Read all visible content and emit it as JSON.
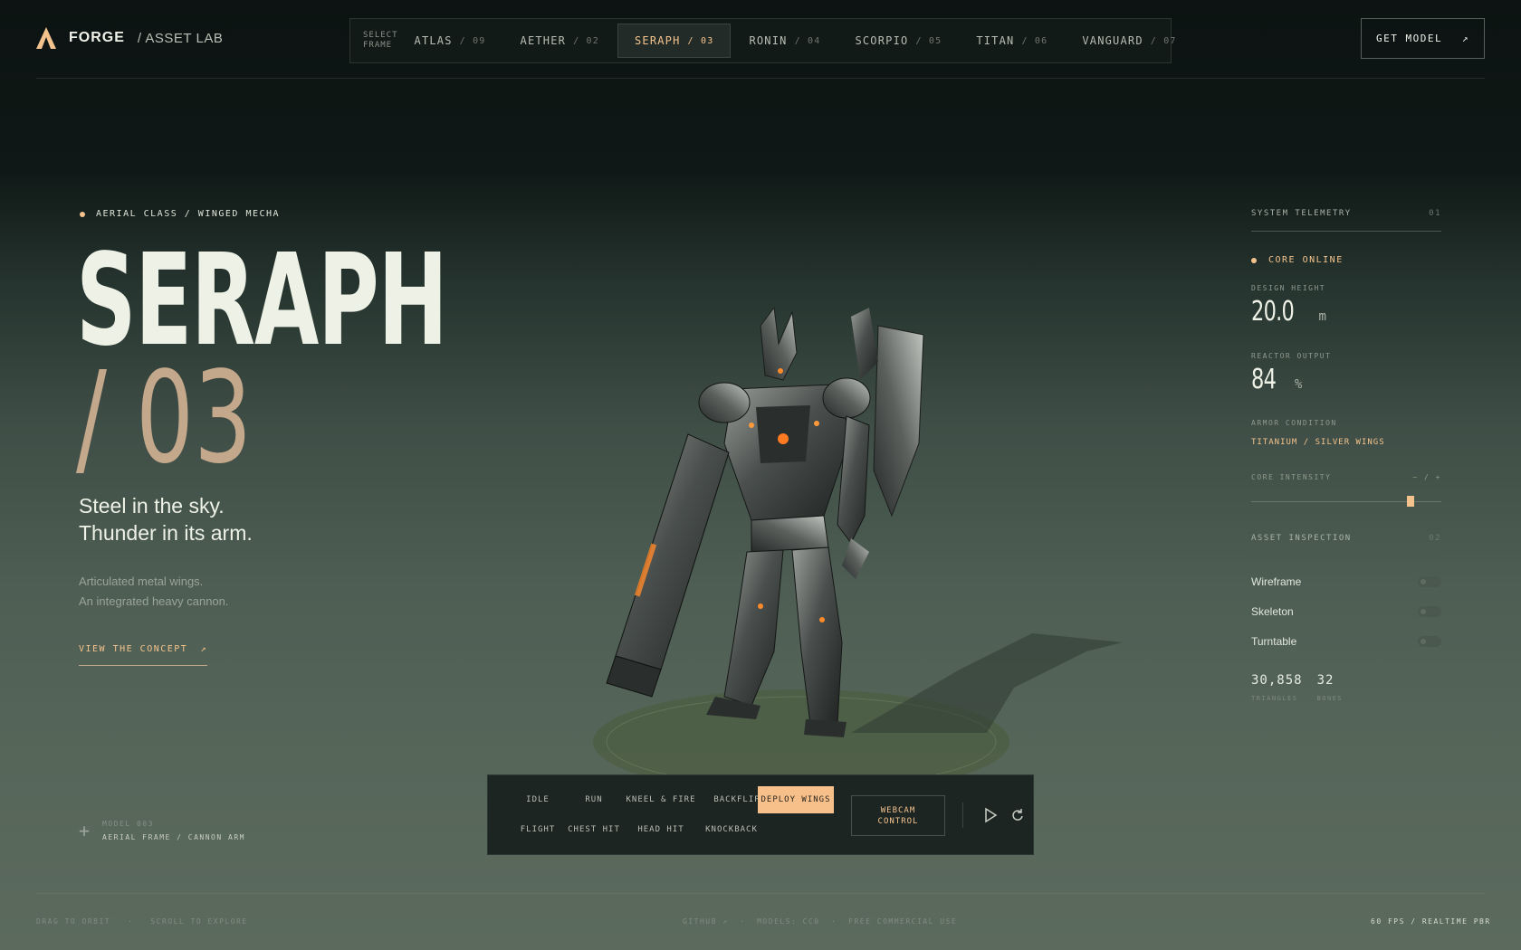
{
  "brand": {
    "name": "FORGE",
    "sub": "/ ASSET LAB"
  },
  "nav": {
    "label": "SELECT FRAME",
    "tabs": [
      {
        "name": "ATLAS",
        "num": "/ 09"
      },
      {
        "name": "AETHER",
        "num": "/ 02"
      },
      {
        "name": "SERAPH",
        "num": "/ 03",
        "active": true
      },
      {
        "name": "RONIN",
        "num": "/ 04"
      },
      {
        "name": "SCORPIO",
        "num": "/ 05"
      },
      {
        "name": "TITAN",
        "num": "/ 06"
      },
      {
        "name": "VANGUARD",
        "num": "/ 07"
      }
    ]
  },
  "header": {
    "get_model": "GET MODEL",
    "get_model_icon": "↗"
  },
  "hero": {
    "class_tag": "AERIAL CLASS / WINGED MECHA",
    "name": "SERAPH",
    "number": "/ 03",
    "tagline_1": "Steel in the sky.",
    "tagline_2": "Thunder in its arm.",
    "desc_1": "Articulated metal wings.",
    "desc_2": "An integrated heavy cannon.",
    "link": "VIEW THE CONCEPT",
    "link_icon": "↗"
  },
  "model_note": {
    "plus": "+",
    "line1": "MODEL 003",
    "line2": "AERIAL FRAME / CANNON ARM"
  },
  "telemetry": {
    "title": "SYSTEM TELEMETRY",
    "index": "01",
    "status": "CORE ONLINE",
    "height_label": "DESIGN HEIGHT",
    "height_value": "20.0",
    "height_unit": "m",
    "reactor_label": "REACTOR OUTPUT",
    "reactor_value": "84",
    "reactor_unit": "%",
    "armor_label": "ARMOR CONDITION",
    "armor_value": "TITANIUM / SILVER WINGS",
    "intensity_label": "CORE INTENSITY",
    "intensity_controls": "− / +",
    "intensity_level": 0.84
  },
  "inspection": {
    "title": "ASSET INSPECTION",
    "index": "02",
    "toggles": [
      {
        "label": "Wireframe",
        "on": false
      },
      {
        "label": "Skeleton",
        "on": false
      },
      {
        "label": "Turntable",
        "on": false
      }
    ],
    "triangles_value": "30,858",
    "triangles_label": "TRIANGLES",
    "bones_value": "32",
    "bones_label": "BONES"
  },
  "animations": {
    "buttons": [
      "IDLE",
      "RUN",
      "KNEEL & FIRE",
      "BACKFLIP",
      "DEPLOY WINGS",
      "FLIGHT",
      "CHEST HIT",
      "HEAD HIT",
      "KNOCKBACK"
    ],
    "active": "DEPLOY WINGS",
    "webcam": "WEBCAM\nCONTROL"
  },
  "footer": {
    "left": "DRAG TO ORBIT   ·   SCROLL TO EXPLORE",
    "center": "GITHUB ↗  ·  MODELS: CC0  ·  FREE COMMERCIAL USE",
    "right": "60 FPS / REALTIME PBR"
  },
  "colors": {
    "accent": "#f4c38d",
    "title": "#eef1e6",
    "number": "#c3a88b"
  }
}
